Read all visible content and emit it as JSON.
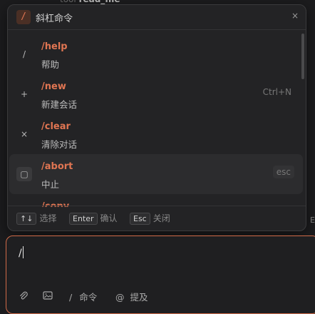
{
  "background": {
    "partial_tool_line": {
      "prefix": "tool",
      "name": "read_file"
    },
    "right_marker": "E"
  },
  "popup": {
    "header": {
      "icon": "/",
      "title": "斜杠命令",
      "close": "×"
    },
    "items": [
      {
        "icon": "/",
        "command": "/help",
        "description": "帮助",
        "shortcut": ""
      },
      {
        "icon": "+",
        "command": "/new",
        "description": "新建会话",
        "shortcut": "Ctrl+N"
      },
      {
        "icon": "×",
        "command": "/clear",
        "description": "清除对话",
        "shortcut": ""
      },
      {
        "icon": "▢",
        "command": "/abort",
        "description": "中止",
        "shortcut": "esc"
      },
      {
        "icon": "",
        "command": "/copy",
        "description": "",
        "shortcut": ""
      }
    ],
    "footer": {
      "navigate_key": "↑↓",
      "navigate_label": "选择",
      "confirm_key": "Enter",
      "confirm_label": "确认",
      "close_key": "Esc",
      "close_label": "关闭"
    }
  },
  "input": {
    "value": "/",
    "toolbar": {
      "command_glyph": "/",
      "command_label": "命令",
      "mention_glyph": "@",
      "mention_label": "提及"
    }
  },
  "colors": {
    "accent": "#e07552",
    "border_focus": "#d06a48",
    "background": "#1c1c1e"
  }
}
